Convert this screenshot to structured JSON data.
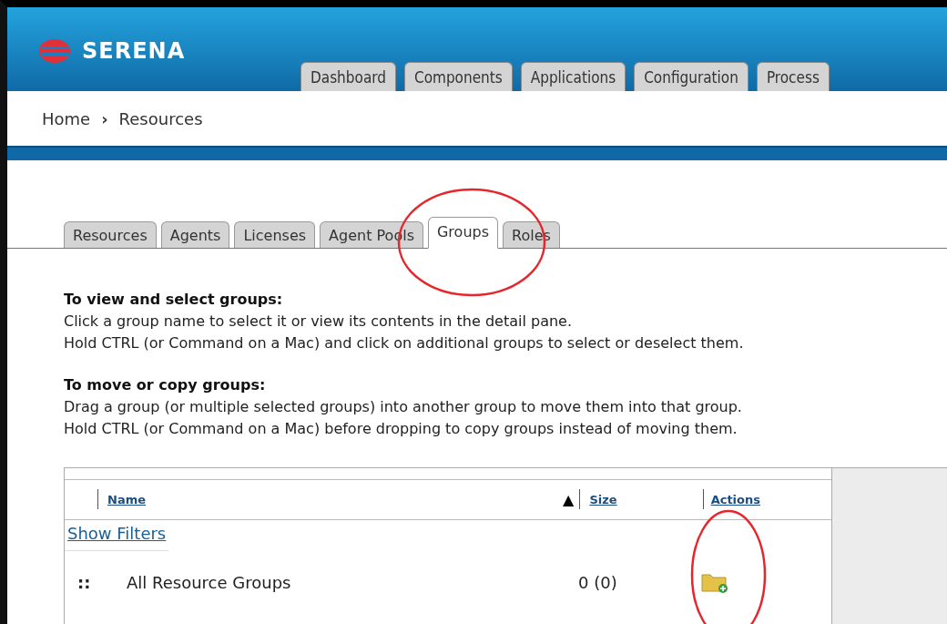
{
  "header": {
    "logo": "SERENA",
    "tabs": [
      {
        "label": "Dashboard",
        "selected": false
      },
      {
        "label": "Components",
        "selected": false
      },
      {
        "label": "Applications",
        "selected": false
      },
      {
        "label": "Configuration",
        "selected": false
      },
      {
        "label": "Process",
        "selected": false
      }
    ]
  },
  "breadcrumb": {
    "items": [
      "Home",
      "Resources"
    ],
    "separator": "›"
  },
  "subtabs": [
    {
      "label": "Resources",
      "selected": false
    },
    {
      "label": "Agents",
      "selected": false
    },
    {
      "label": "Licenses",
      "selected": false
    },
    {
      "label": "Agent Pools",
      "selected": false
    },
    {
      "label": "Groups",
      "selected": true
    },
    {
      "label": "Roles",
      "selected": false
    }
  ],
  "help": [
    {
      "heading": "To view and select groups:",
      "lines": [
        "Click a group name to select it or view its contents in the detail pane.",
        "Hold CTRL (or Command on a Mac) and click on additional groups to select or deselect them."
      ]
    },
    {
      "heading": "To move or copy groups:",
      "lines": [
        "Drag a group (or multiple selected groups) into another group to move them into that group.",
        "Hold CTRL (or Command on a Mac) before dropping to copy groups instead of moving them."
      ]
    }
  ],
  "table": {
    "columns": [
      "Name",
      "Size",
      "Actions"
    ],
    "sort_indicator": "▲",
    "show_filters": "Show Filters",
    "rows": [
      {
        "handle": "::",
        "name": "All Resource Groups",
        "size": "0 (0)"
      }
    ]
  }
}
